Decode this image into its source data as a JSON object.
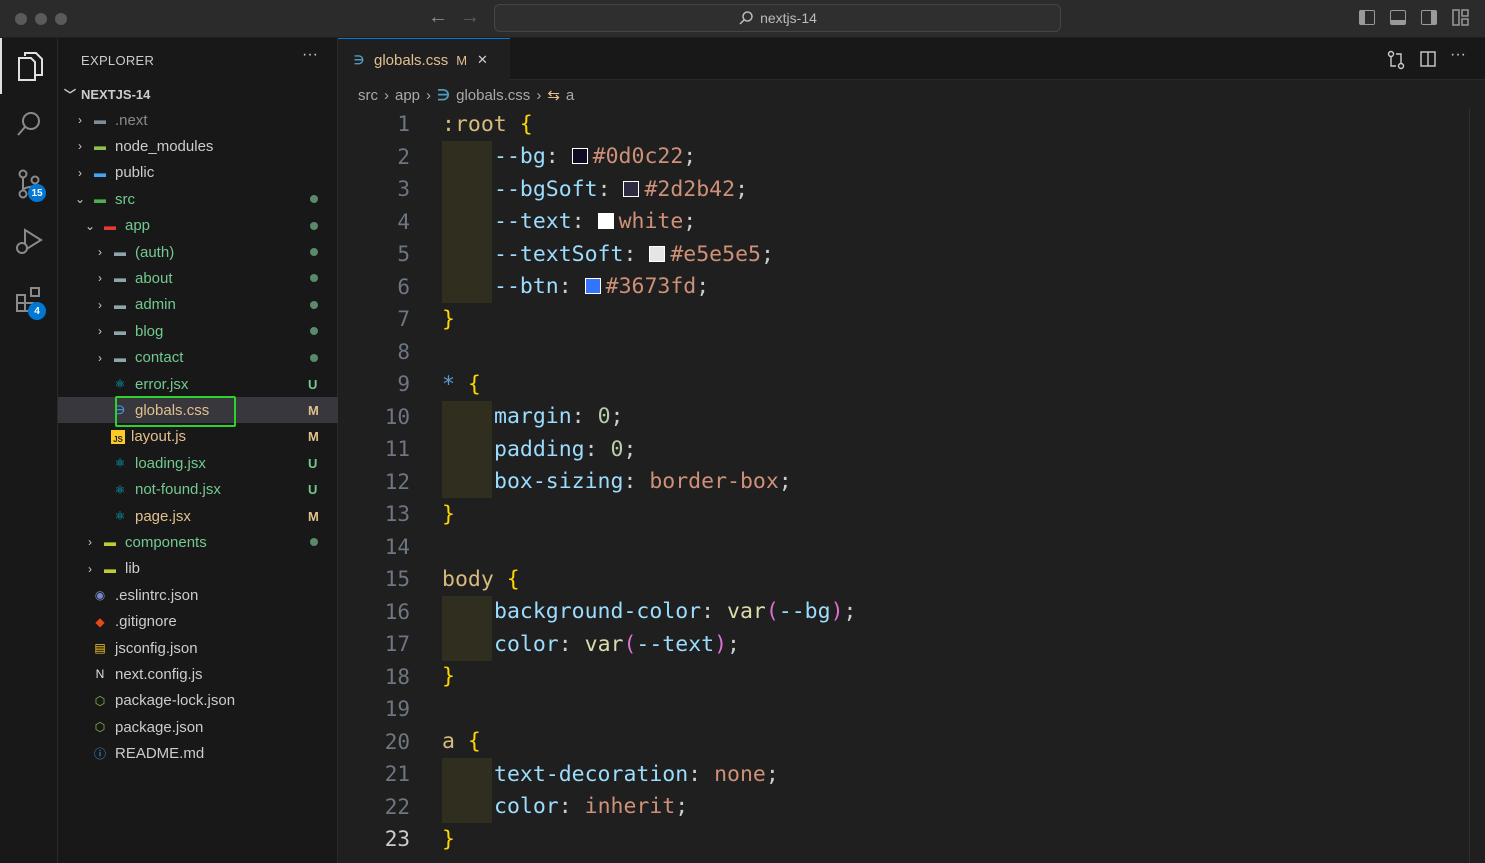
{
  "window": {
    "search_text": "nextjs-14",
    "colors": {
      "accent": "#0078d4",
      "highlight_box": "#2fd12f",
      "modified": "#e2c08d",
      "untracked": "#73c991"
    }
  },
  "activity_bar": {
    "items": [
      {
        "name": "explorer-icon",
        "active": true
      },
      {
        "name": "search-icon"
      },
      {
        "name": "source-control-icon",
        "badge": "15"
      },
      {
        "name": "run-debug-icon"
      },
      {
        "name": "extensions-icon",
        "badge": "4"
      }
    ]
  },
  "sidebar": {
    "title": "EXPLORER",
    "more": "···",
    "root_label": "NEXTJS-14",
    "tree": [
      {
        "label": ".next",
        "status": "",
        "color": "#8b8b8b",
        "icon": "folder-config-icon"
      },
      {
        "label": "node_modules",
        "status": "",
        "color": "#cccccc",
        "icon": "folder-node-icon"
      },
      {
        "label": "public",
        "status": "",
        "color": "#cccccc",
        "icon": "folder-public-icon"
      },
      {
        "label": "src",
        "status": "dot",
        "color": "#73c991",
        "icon": "folder-src-icon"
      },
      {
        "label": "app",
        "status": "dot",
        "color": "#73c991",
        "icon": "folder-app-icon"
      },
      {
        "label": "(auth)",
        "status": "dot",
        "color": "#73c991",
        "icon": "folder-icon"
      },
      {
        "label": "about",
        "status": "dot",
        "color": "#73c991",
        "icon": "folder-icon"
      },
      {
        "label": "admin",
        "status": "dot",
        "color": "#73c991",
        "icon": "folder-admin-icon"
      },
      {
        "label": "blog",
        "status": "dot",
        "color": "#73c991",
        "icon": "folder-icon"
      },
      {
        "label": "contact",
        "status": "dot",
        "color": "#73c991",
        "icon": "folder-icon"
      },
      {
        "label": "error.jsx",
        "status": "U",
        "color": "#73c991",
        "icon": "react-icon"
      },
      {
        "label": "globals.css",
        "status": "M",
        "color": "#e2c08d",
        "icon": "css-icon"
      },
      {
        "label": "layout.js",
        "status": "M",
        "color": "#e2c08d",
        "icon": "js-icon"
      },
      {
        "label": "loading.jsx",
        "status": "U",
        "color": "#73c991",
        "icon": "react-icon"
      },
      {
        "label": "not-found.jsx",
        "status": "U",
        "color": "#73c991",
        "icon": "react-icon"
      },
      {
        "label": "page.jsx",
        "status": "M",
        "color": "#e2c08d",
        "icon": "react-icon"
      },
      {
        "label": "components",
        "status": "dot",
        "color": "#73c991",
        "icon": "folder-components-icon"
      },
      {
        "label": "lib",
        "status": "",
        "color": "#cccccc",
        "icon": "folder-lib-icon"
      },
      {
        "label": ".eslintrc.json",
        "status": "",
        "color": "#cccccc",
        "icon": "eslint-icon"
      },
      {
        "label": ".gitignore",
        "status": "",
        "color": "#cccccc",
        "icon": "git-icon"
      },
      {
        "label": "jsconfig.json",
        "status": "",
        "color": "#cccccc",
        "icon": "jsconfig-icon"
      },
      {
        "label": "next.config.js",
        "status": "",
        "color": "#cccccc",
        "icon": "next-icon"
      },
      {
        "label": "package-lock.json",
        "status": "",
        "color": "#cccccc",
        "icon": "npm-icon"
      },
      {
        "label": "package.json",
        "status": "",
        "color": "#cccccc",
        "icon": "npm-icon"
      },
      {
        "label": "README.md",
        "status": "",
        "color": "#cccccc",
        "icon": "info-icon"
      }
    ]
  },
  "editor": {
    "tab": {
      "label": "globals.css",
      "status": "M",
      "close": "✕"
    },
    "breadcrumb": [
      "src",
      "app",
      "globals.css",
      "a"
    ],
    "current_line": 23,
    "lines": [
      ":root {",
      "  --bg: #0d0c22;",
      "  --bgSoft: #2d2b42;",
      "  --text: white;",
      "  --textSoft: #e5e5e5;",
      "  --btn: #3673fd;",
      "}",
      "",
      "* {",
      "  margin: 0;",
      "  padding: 0;",
      "  box-sizing: border-box;",
      "}",
      "",
      "body {",
      "  background-color: var(--bg);",
      "  color: var(--text);",
      "}",
      "",
      "a {",
      "  text-decoration: none;",
      "  color: inherit;",
      "}"
    ],
    "swatches": {
      "#0d0c22": "#0d0c22",
      "#2d2b42": "#2d2b42",
      "white": "#ffffff",
      "#e5e5e5": "#e5e5e5",
      "#3673fd": "#3673fd"
    }
  }
}
